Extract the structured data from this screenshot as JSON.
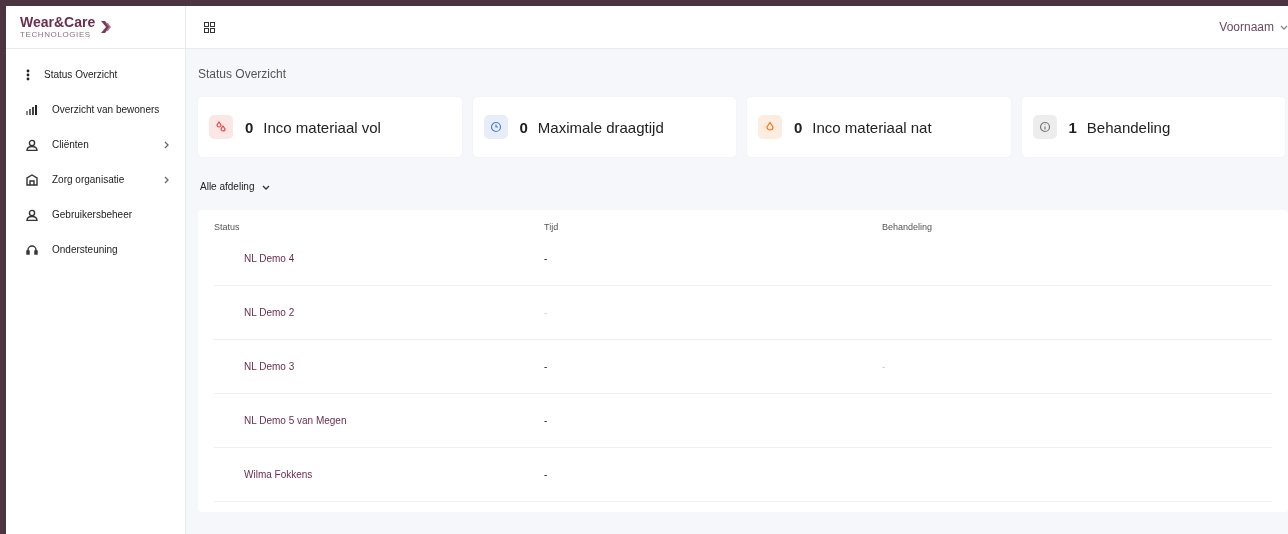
{
  "logo": {
    "name": "Wear&Care",
    "tagline": "TECHNOLOGIES"
  },
  "sidebar": {
    "items": [
      {
        "label": "Status Overzicht",
        "kind": "dots",
        "has_submenu": false
      },
      {
        "label": "Overzicht van bewoners",
        "kind": "bars",
        "has_submenu": false
      },
      {
        "label": "Cliënten",
        "kind": "user",
        "has_submenu": true
      },
      {
        "label": "Zorg organisatie",
        "kind": "building",
        "has_submenu": true
      },
      {
        "label": "Gebruikersbeheer",
        "kind": "user",
        "has_submenu": false
      },
      {
        "label": "Ondersteuning",
        "kind": "headset",
        "has_submenu": false
      }
    ]
  },
  "header": {
    "user": "Voornaam"
  },
  "page_title": "Status Overzicht",
  "stats": [
    {
      "count": "0",
      "label": "Inco materiaal vol",
      "kind": "drops",
      "color": "#e84a4a"
    },
    {
      "count": "0",
      "label": "Maximale draagtijd",
      "kind": "clock",
      "color": "#4a7fd6"
    },
    {
      "count": "0",
      "label": "Inco materiaal nat",
      "kind": "drop",
      "color": "#f07a1a"
    },
    {
      "count": "1",
      "label": "Behandeling",
      "kind": "info",
      "color": "#777777"
    }
  ],
  "filter": {
    "value": "Alle afdeling"
  },
  "table": {
    "columns": [
      "Status",
      "Tijd",
      "Behandeling"
    ],
    "rows": [
      {
        "name": "NL Demo 4",
        "tijd": "-",
        "tijd_faint": false
      },
      {
        "name": "NL Demo 2",
        "tijd": "-",
        "tijd_faint": true
      },
      {
        "name": "NL Demo 3",
        "tijd": "-",
        "tijd_faint": false,
        "behandeling": "-"
      },
      {
        "name": "NL Demo 5 van Megen",
        "tijd": "-",
        "tijd_faint": false
      },
      {
        "name": "Wilma Fokkens",
        "tijd": "-",
        "tijd_faint": false
      }
    ]
  }
}
